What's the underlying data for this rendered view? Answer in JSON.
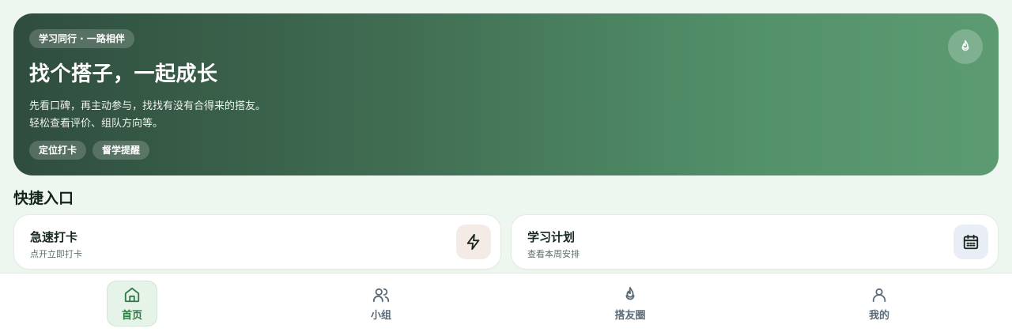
{
  "hero": {
    "badge": "学习同行 · 一路相伴",
    "title": "找个搭子，一起成长",
    "desc_line1": "先看口碑，再主动参与，找找有没有合得来的搭友。",
    "desc_line2": "轻松查看评价、组队方向等。",
    "tags": [
      "定位打卡",
      "督学提醒"
    ],
    "icon": "flame-icon"
  },
  "quick": {
    "section_title": "快捷入口",
    "cards": [
      {
        "title": "急速打卡",
        "subtitle": "点开立即打卡",
        "icon": "lightning-icon"
      },
      {
        "title": "学习计划",
        "subtitle": "查看本周安排",
        "icon": "calendar-icon"
      }
    ]
  },
  "nav": {
    "items": [
      {
        "label": "首页",
        "icon": "home-icon",
        "active": true
      },
      {
        "label": "小组",
        "icon": "users-icon",
        "active": false
      },
      {
        "label": "搭友圈",
        "icon": "flame-icon",
        "active": false
      },
      {
        "label": "我的",
        "icon": "user-icon",
        "active": false
      }
    ]
  },
  "colors": {
    "hero_gradient_start": "#2f4d3e",
    "hero_gradient_end": "#5c9b72",
    "accent_green": "#2f7a45",
    "nav_inactive": "#5b6b78"
  }
}
